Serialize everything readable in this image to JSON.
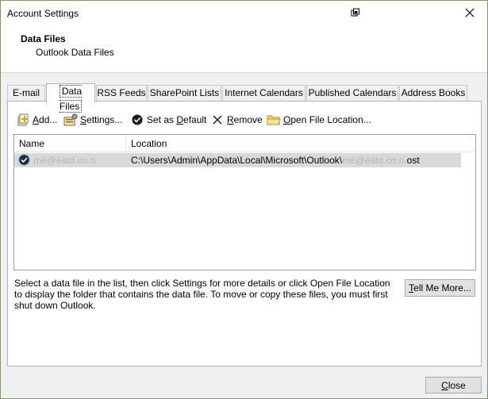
{
  "window": {
    "title": "Account Settings",
    "restore_icon": "restore-window-icon",
    "close_icon": "close-icon"
  },
  "header": {
    "title": "Data Files",
    "subtitle": "Outlook Data Files"
  },
  "tabs": [
    {
      "label": "E-mail",
      "active": false
    },
    {
      "label": "Data Files",
      "active": true
    },
    {
      "label": "RSS Feeds",
      "active": false
    },
    {
      "label": "SharePoint Lists",
      "active": false
    },
    {
      "label": "Internet Calendars",
      "active": false
    },
    {
      "label": "Published Calendars",
      "active": false
    },
    {
      "label": "Address Books",
      "active": false
    }
  ],
  "toolbar": {
    "add": {
      "pre": "",
      "key": "A",
      "post": "dd..."
    },
    "settings": {
      "pre": "",
      "key": "S",
      "post": "ettings..."
    },
    "set_default": {
      "pre": "Set as ",
      "key": "D",
      "post": "efault"
    },
    "remove": {
      "pre": "",
      "key": "R",
      "post": "emove"
    },
    "open_location": {
      "pre": "",
      "key": "O",
      "post": "pen File Location..."
    }
  },
  "list": {
    "columns": [
      "Name",
      "Location"
    ],
    "rows": [
      {
        "name": "mé@éátd.co.n",
        "location_prefix": "C:\\Users\\Admin\\AppData\\Local\\Microsoft\\Outlook\\",
        "location_blurred": "mé@éátd.co.n.",
        "location_suffix": "ost"
      }
    ]
  },
  "description": "Select a data file in the list, then click Settings for more details or click Open File Location to display the folder that contains the data file. To move or copy these files, you must first shut down Outlook.",
  "buttons": {
    "tell_me": {
      "pre": "",
      "key": "T",
      "post": "ell Me More..."
    },
    "close": {
      "pre": "",
      "key": "C",
      "post": "lose"
    }
  },
  "colors": {
    "window_border": "#7a9a6e",
    "selected_row": "#d9d9d9",
    "dialog_bg": "#f0f0f0"
  }
}
